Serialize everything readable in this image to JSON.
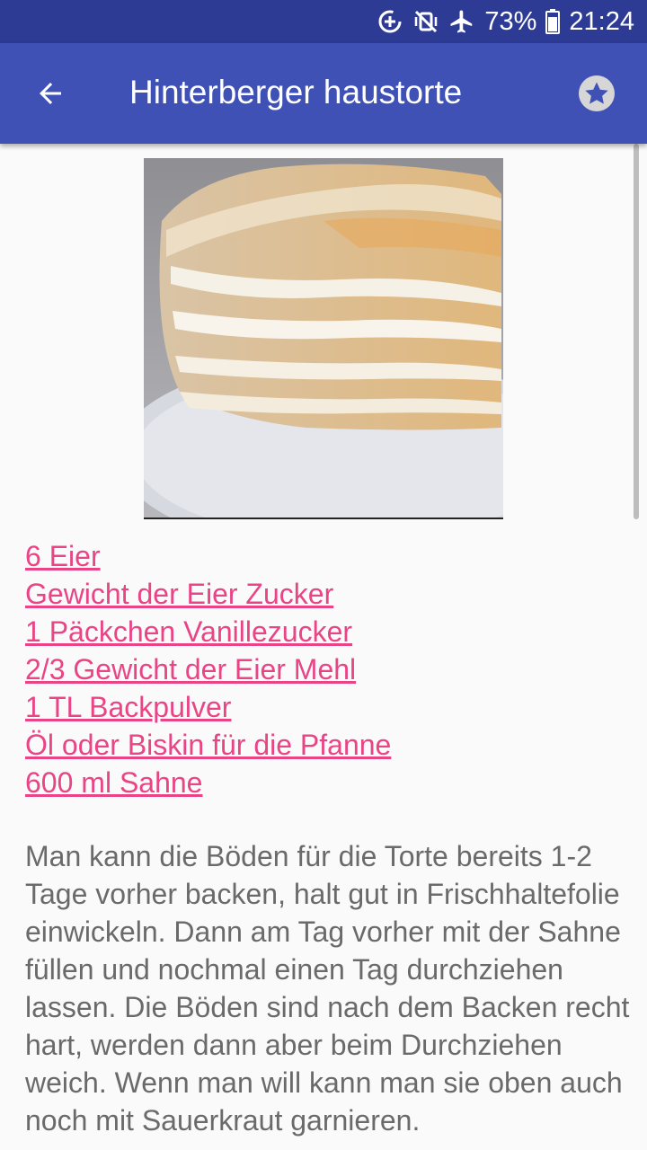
{
  "status_bar": {
    "battery_percent": "73%",
    "time": "21:24",
    "icons": [
      "data-saver-icon",
      "vibrate-mute-icon",
      "airplane-mode-icon",
      "battery-icon"
    ]
  },
  "app_bar": {
    "title": "Hinterberger haustorte",
    "back_icon": "arrow-back-icon",
    "favorite_icon": "star-icon"
  },
  "recipe": {
    "image_icon": "cake-photo",
    "ingredients": [
      "6 Eier",
      "Gewicht der Eier Zucker",
      "1 Päckchen Vanillezucker",
      "2/3 Gewicht der Eier Mehl",
      "1 TL Backpulver",
      "Öl oder Biskin für die Pfanne",
      "600 ml Sahne"
    ],
    "instructions": "Man kann die Böden für die Torte bereits 1-2 Tage vorher backen, halt gut in Frischhaltefolie einwickeln. Dann am Tag vorher mit der Sahne füllen und nochmal einen Tag durchziehen lassen. Die Böden sind nach dem Backen recht hart, werden dann aber beim Durchziehen weich. Wenn man will kann man sie oben auch noch mit Sauerkraut garnieren."
  },
  "colors": {
    "status_bar": "#2d3b95",
    "app_bar": "#3f51b5",
    "ingredient_link": "#e94586",
    "body_text": "#6a6a6a",
    "background": "#fafafa"
  }
}
